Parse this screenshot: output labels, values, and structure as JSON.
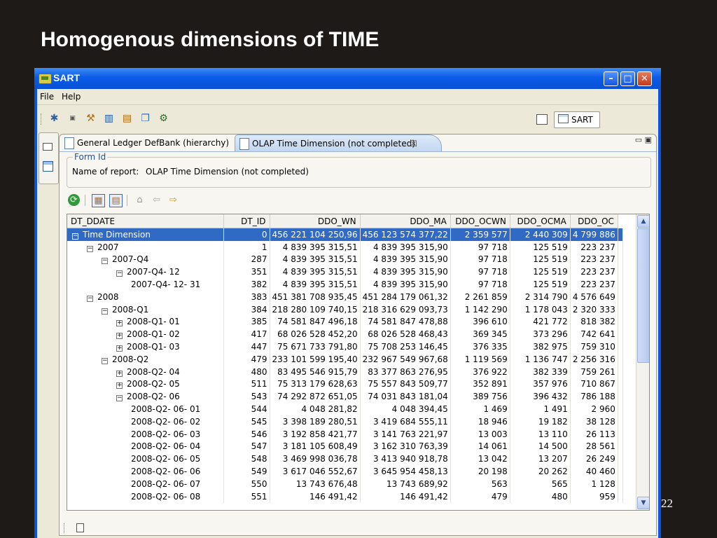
{
  "slide": {
    "title": "Homogenous dimensions of TIME",
    "page_number": "22"
  },
  "window": {
    "title": "SART",
    "min_glyph": "–",
    "max_glyph": "□",
    "close_glyph": "✕"
  },
  "menu": {
    "file": "File",
    "help": "Help"
  },
  "toolbar": {
    "icons": [
      "gear-icon",
      "gif-icon",
      "tools-icon",
      "columns-icon",
      "documents-icon",
      "copy-icon",
      "settings-icon"
    ]
  },
  "perspective": {
    "label": "SART"
  },
  "tabs": [
    {
      "label": "General Ledger DefBank (hierarchy)"
    },
    {
      "label": "OLAP Time Dimension (not completed)",
      "close": "☒"
    }
  ],
  "form": {
    "legend": "Form Id",
    "name_label": "Name of report:",
    "name_value": "OLAP Time Dimension (not completed)"
  },
  "table": {
    "columns": [
      "DT_DDATE",
      "DT_ID",
      "DDO_WN",
      "DDO_MA",
      "DDO_OCWN",
      "DDO_OCMA",
      "DDO_OC"
    ],
    "rows": [
      {
        "indent": 0,
        "toggle": "−",
        "label": "Time Dimension",
        "dt_id": "0",
        "wn": "456 221 104 250,96",
        "ma": "456 123 574 377,22",
        "ocwn": "2 359 577",
        "ocma": "2 440 309",
        "oc": "4 799 886",
        "selected": true
      },
      {
        "indent": 1,
        "toggle": "−",
        "label": "2007",
        "dt_id": "1",
        "wn": "4 839 395 315,51",
        "ma": "4 839 395 315,90",
        "ocwn": "97 718",
        "ocma": "125 519",
        "oc": "223 237"
      },
      {
        "indent": 2,
        "toggle": "−",
        "label": "2007-Q4",
        "dt_id": "287",
        "wn": "4 839 395 315,51",
        "ma": "4 839 395 315,90",
        "ocwn": "97 718",
        "ocma": "125 519",
        "oc": "223 237"
      },
      {
        "indent": 3,
        "toggle": "−",
        "label": "2007-Q4- 12",
        "dt_id": "351",
        "wn": "4 839 395 315,51",
        "ma": "4 839 395 315,90",
        "ocwn": "97 718",
        "ocma": "125 519",
        "oc": "223 237"
      },
      {
        "indent": 4,
        "toggle": "",
        "label": "2007-Q4- 12- 31",
        "dt_id": "382",
        "wn": "4 839 395 315,51",
        "ma": "4 839 395 315,90",
        "ocwn": "97 718",
        "ocma": "125 519",
        "oc": "223 237"
      },
      {
        "indent": 1,
        "toggle": "−",
        "label": "2008",
        "dt_id": "383",
        "wn": "451 381 708 935,45",
        "ma": "451 284 179 061,32",
        "ocwn": "2 261 859",
        "ocma": "2 314 790",
        "oc": "4 576 649"
      },
      {
        "indent": 2,
        "toggle": "−",
        "label": "2008-Q1",
        "dt_id": "384",
        "wn": "218 280 109 740,15",
        "ma": "218 316 629 093,73",
        "ocwn": "1 142 290",
        "ocma": "1 178 043",
        "oc": "2 320 333"
      },
      {
        "indent": 3,
        "toggle": "+",
        "label": "2008-Q1- 01",
        "dt_id": "385",
        "wn": "74 581 847 496,18",
        "ma": "74 581 847 478,88",
        "ocwn": "396 610",
        "ocma": "421 772",
        "oc": "818 382"
      },
      {
        "indent": 3,
        "toggle": "+",
        "label": "2008-Q1- 02",
        "dt_id": "417",
        "wn": "68 026 528 452,20",
        "ma": "68 026 528 468,43",
        "ocwn": "369 345",
        "ocma": "373 296",
        "oc": "742 641"
      },
      {
        "indent": 3,
        "toggle": "+",
        "label": "2008-Q1- 03",
        "dt_id": "447",
        "wn": "75 671 733 791,80",
        "ma": "75 708 253 146,45",
        "ocwn": "376 335",
        "ocma": "382 975",
        "oc": "759 310"
      },
      {
        "indent": 2,
        "toggle": "−",
        "label": "2008-Q2",
        "dt_id": "479",
        "wn": "233 101 599 195,40",
        "ma": "232 967 549 967,68",
        "ocwn": "1 119 569",
        "ocma": "1 136 747",
        "oc": "2 256 316"
      },
      {
        "indent": 3,
        "toggle": "+",
        "label": "2008-Q2- 04",
        "dt_id": "480",
        "wn": "83 495 546 915,79",
        "ma": "83 377 863 276,95",
        "ocwn": "376 922",
        "ocma": "382 339",
        "oc": "759 261"
      },
      {
        "indent": 3,
        "toggle": "+",
        "label": "2008-Q2- 05",
        "dt_id": "511",
        "wn": "75 313 179 628,63",
        "ma": "75 557 843 509,77",
        "ocwn": "352 891",
        "ocma": "357 976",
        "oc": "710 867"
      },
      {
        "indent": 3,
        "toggle": "−",
        "label": "2008-Q2- 06",
        "dt_id": "543",
        "wn": "74 292 872 651,05",
        "ma": "74 031 843 181,04",
        "ocwn": "389 756",
        "ocma": "396 432",
        "oc": "786 188"
      },
      {
        "indent": 4,
        "toggle": "",
        "label": "2008-Q2- 06- 01",
        "dt_id": "544",
        "wn": "4 048 281,82",
        "ma": "4 048 394,45",
        "ocwn": "1 469",
        "ocma": "1 491",
        "oc": "2 960"
      },
      {
        "indent": 4,
        "toggle": "",
        "label": "2008-Q2- 06- 02",
        "dt_id": "545",
        "wn": "3 398 189 280,51",
        "ma": "3 419 684 555,11",
        "ocwn": "18 946",
        "ocma": "19 182",
        "oc": "38 128"
      },
      {
        "indent": 4,
        "toggle": "",
        "label": "2008-Q2- 06- 03",
        "dt_id": "546",
        "wn": "3 192 858 421,77",
        "ma": "3 141 763 221,97",
        "ocwn": "13 003",
        "ocma": "13 110",
        "oc": "26 113"
      },
      {
        "indent": 4,
        "toggle": "",
        "label": "2008-Q2- 06- 04",
        "dt_id": "547",
        "wn": "3 181 105 608,49",
        "ma": "3 162 310 763,39",
        "ocwn": "14 061",
        "ocma": "14 500",
        "oc": "28 561"
      },
      {
        "indent": 4,
        "toggle": "",
        "label": "2008-Q2- 06- 05",
        "dt_id": "548",
        "wn": "3 469 998 036,78",
        "ma": "3 413 940 918,78",
        "ocwn": "13 042",
        "ocma": "13 207",
        "oc": "26 249"
      },
      {
        "indent": 4,
        "toggle": "",
        "label": "2008-Q2- 06- 06",
        "dt_id": "549",
        "wn": "3 617 046 552,67",
        "ma": "3 645 954 458,13",
        "ocwn": "20 198",
        "ocma": "20 262",
        "oc": "40 460"
      },
      {
        "indent": 4,
        "toggle": "",
        "label": "2008-Q2- 06- 07",
        "dt_id": "550",
        "wn": "13 743 676,48",
        "ma": "13 743 689,92",
        "ocwn": "563",
        "ocma": "565",
        "oc": "1 128"
      },
      {
        "indent": 4,
        "toggle": "",
        "label": "2008-Q2- 06- 08",
        "dt_id": "551",
        "wn": "146 491,42",
        "ma": "146 491,42",
        "ocwn": "479",
        "ocma": "480",
        "oc": "959"
      }
    ]
  }
}
